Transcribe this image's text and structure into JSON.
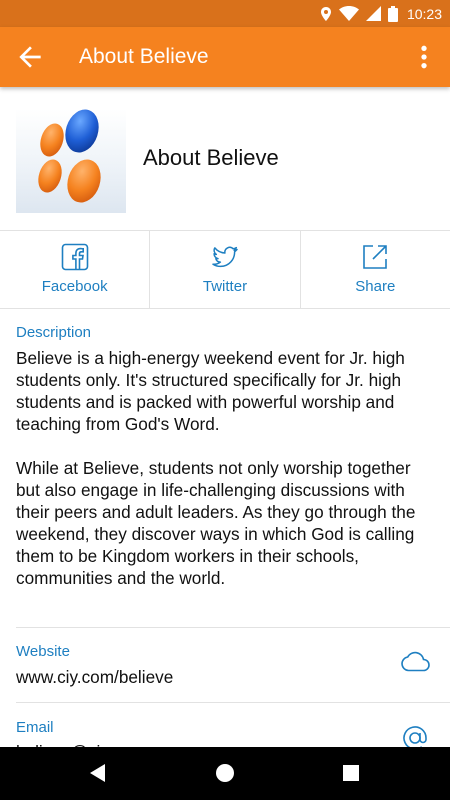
{
  "status_bar": {
    "time": "10:23",
    "icons": [
      "location-icon",
      "wifi-icon",
      "signal-icon",
      "battery-icon"
    ]
  },
  "app_bar": {
    "title": "About Believe",
    "back_icon": "arrow-back-icon",
    "more_icon": "more-vert-icon"
  },
  "header": {
    "title": "About Believe"
  },
  "actions": [
    {
      "label": "Facebook",
      "icon": "facebook-icon"
    },
    {
      "label": "Twitter",
      "icon": "twitter-icon"
    },
    {
      "label": "Share",
      "icon": "share-icon"
    }
  ],
  "description": {
    "label": "Description",
    "paragraphs": [
      "Believe is a high-energy weekend event for Jr. high students only. It's structured specifically for Jr. high students and is packed with powerful worship and teaching from God's Word.",
      "While at Believe, students not only worship together but also engage in life-challenging discussions with their peers and adult leaders. As they go through the weekend, they discover ways in which God is calling them to be Kingdom workers in their schools, communities and the world."
    ]
  },
  "website": {
    "label": "Website",
    "value": "www.ciy.com/believe",
    "icon": "cloud-icon"
  },
  "email": {
    "label": "Email",
    "value": "believe@ciy.com",
    "icon": "at-sign-icon"
  },
  "colors": {
    "status_bar": "#d9711b",
    "app_bar": "#f5821f",
    "accent": "#1e7fc1"
  }
}
